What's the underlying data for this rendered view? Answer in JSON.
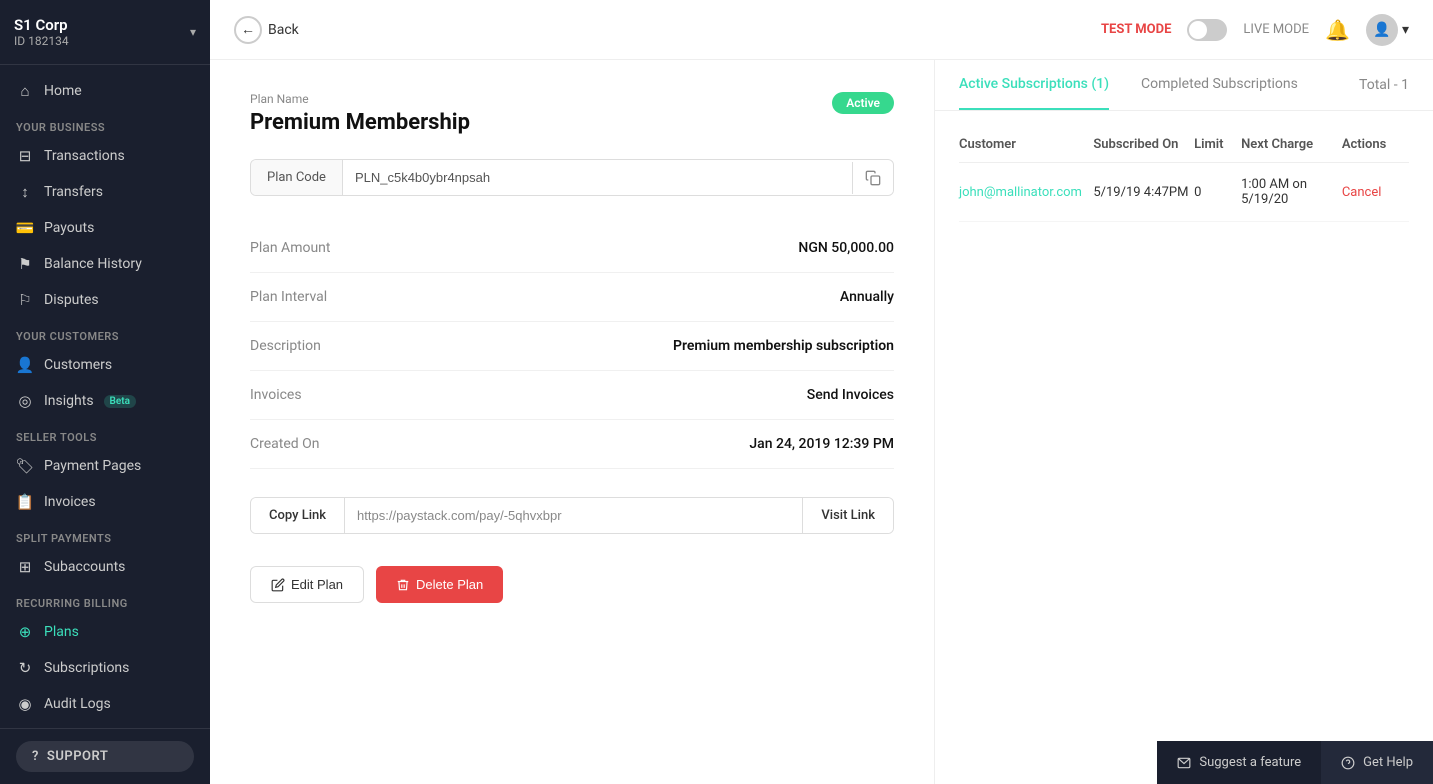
{
  "sidebar": {
    "company_name": "S1 Corp",
    "company_id": "ID 182134",
    "chevron": "▾",
    "nav": {
      "home_label": "Home",
      "section_your_business": "YOUR BUSINESS",
      "transactions_label": "Transactions",
      "transfers_label": "Transfers",
      "payouts_label": "Payouts",
      "balance_history_label": "Balance History",
      "disputes_label": "Disputes",
      "section_your_customers": "YOUR CUSTOMERS",
      "customers_label": "Customers",
      "insights_label": "Insights",
      "insights_beta": "Beta",
      "section_seller_tools": "SELLER TOOLS",
      "payment_pages_label": "Payment Pages",
      "invoices_label": "Invoices",
      "section_split_payments": "SPLIT PAYMENTS",
      "subaccounts_label": "Subaccounts",
      "section_recurring_billing": "RECURRING BILLING",
      "plans_label": "Plans",
      "subscriptions_label": "Subscriptions",
      "audit_logs_label": "Audit Logs"
    },
    "support_label": "SUPPORT"
  },
  "topbar": {
    "back_label": "Back",
    "test_mode_label": "TEST MODE",
    "live_mode_label": "LIVE MODE"
  },
  "plan": {
    "name_field_label": "Plan Name",
    "title": "Premium Membership",
    "status": "Active",
    "plan_code_label": "Plan Code",
    "plan_code_value": "PLN_c5k4b0ybr4npsah",
    "plan_amount_label": "Plan Amount",
    "plan_amount_value": "NGN 50,000.00",
    "plan_interval_label": "Plan Interval",
    "plan_interval_value": "Annually",
    "description_label": "Description",
    "description_value": "Premium membership subscription",
    "invoices_label": "Invoices",
    "invoices_value": "Send Invoices",
    "created_on_label": "Created On",
    "created_on_value": "Jan 24, 2019 12:39 PM",
    "copy_link_label": "Copy Link",
    "link_url": "https://paystack.com/pay/-5qhvxbpr",
    "visit_link_label": "Visit Link",
    "edit_plan_label": "Edit Plan",
    "delete_plan_label": "Delete Plan"
  },
  "subscriptions": {
    "tab_active_label": "Active Subscriptions (1)",
    "tab_completed_label": "Completed Subscriptions",
    "total_label": "Total - 1",
    "columns": {
      "customer": "Customer",
      "subscribed_on": "Subscribed On",
      "limit": "Limit",
      "next_charge": "Next Charge",
      "actions": "Actions"
    },
    "rows": [
      {
        "customer": "john@mallinator.com",
        "subscribed_on": "5/19/19 4:47PM",
        "limit": "0",
        "next_charge": "1:00 AM on 5/19/20",
        "action": "Cancel"
      }
    ]
  },
  "footer": {
    "suggest_label": "Suggest a feature",
    "get_help_label": "Get Help"
  }
}
